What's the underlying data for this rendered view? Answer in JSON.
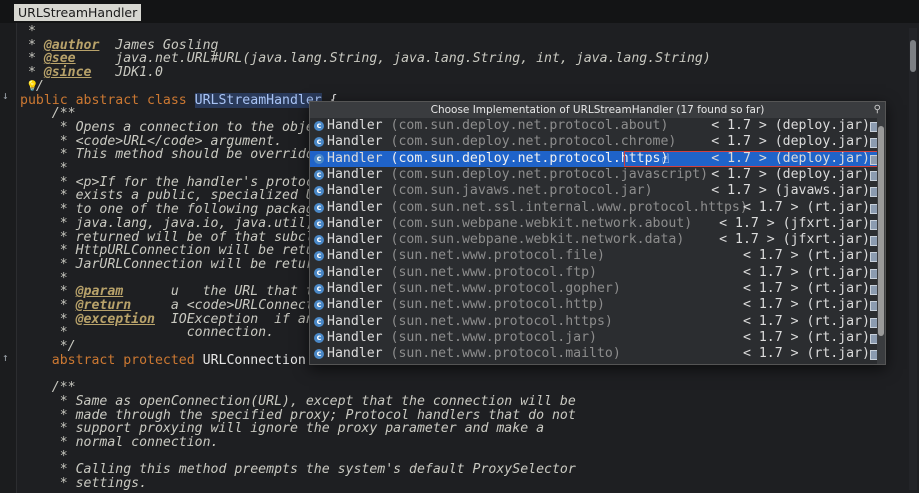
{
  "tab_title": "URLStreamHandler",
  "code_lines": [
    {
      "kind": "doc",
      "text": " *"
    },
    {
      "kind": "tagged",
      "tag": "@author",
      "rest": "  James Gosling"
    },
    {
      "kind": "tagged",
      "tag": "@see",
      "rest": "     java.net.URL#URL(java.lang.String, java.lang.String, int, java.lang.String)"
    },
    {
      "kind": "tagged",
      "tag": "@since",
      "rest": "   JDK1.0"
    },
    {
      "kind": "doc",
      "text": " */"
    },
    {
      "kind": "decl",
      "kw": "public abstract class ",
      "name": "URLStreamHandler",
      "rest": " {"
    },
    {
      "kind": "doc",
      "text": "    /**"
    },
    {
      "kind": "doc",
      "text": "     * Opens a connection to the objec"
    },
    {
      "kind": "doc",
      "text": "     * <code>URL</code> argument."
    },
    {
      "kind": "doc",
      "text": "     * This method should be overridde"
    },
    {
      "kind": "doc",
      "text": "     *"
    },
    {
      "kind": "doc",
      "text": "     * <p>If for the handler's protoco"
    },
    {
      "kind": "doc",
      "text": "     * exists a public, specialized UR"
    },
    {
      "kind": "doc",
      "text": "     * to one of the following package"
    },
    {
      "kind": "doc",
      "text": "     * java.lang, java.io, java.util, "
    },
    {
      "kind": "doc",
      "text": "     * returned will be of that subcla"
    },
    {
      "kind": "doc",
      "text": "     * HttpURLConnection will be retur"
    },
    {
      "kind": "doc",
      "text": "     * JarURLConnection will be return"
    },
    {
      "kind": "doc",
      "text": "     *"
    },
    {
      "kind": "tagged2",
      "tag": "@param",
      "rest": "      u   the URL that th"
    },
    {
      "kind": "tagged2",
      "tag": "@return",
      "rest": "     a <code>URLConnecti"
    },
    {
      "kind": "tagged2",
      "tag": "@exception",
      "rest": "  IOException  if an"
    },
    {
      "kind": "doc",
      "text": "     *               connection."
    },
    {
      "kind": "doc",
      "text": "     */"
    },
    {
      "kind": "decl2",
      "kw": "    abstract protected ",
      "rest": "URLConnection o"
    },
    {
      "kind": "doc",
      "text": ""
    },
    {
      "kind": "doc",
      "text": "    /**"
    },
    {
      "kind": "doc",
      "text": "     * Same as openConnection(URL), except that the connection will be"
    },
    {
      "kind": "doc",
      "text": "     * made through the specified proxy; Protocol handlers that do not"
    },
    {
      "kind": "doc",
      "text": "     * support proxying will ignore the proxy parameter and make a"
    },
    {
      "kind": "doc",
      "text": "     * normal connection."
    },
    {
      "kind": "doc",
      "text": "     *"
    },
    {
      "kind": "doc",
      "text": "     * Calling this method preempts the system's default ProxySelector"
    },
    {
      "kind": "doc",
      "text": "     * settings."
    }
  ],
  "popup": {
    "title": "Choose Implementation of URLStreamHandler (17 found so far)",
    "selected_index": 2,
    "items": [
      {
        "name": "Handler",
        "pkg": "(com.sun.deploy.net.protocol.about)",
        "version": "< 1.7 >",
        "jar": "(deploy.jar)"
      },
      {
        "name": "Handler",
        "pkg": "(com.sun.deploy.net.protocol.chrome)",
        "version": "< 1.7 >",
        "jar": "(deploy.jar)"
      },
      {
        "name": "Handler",
        "pkg": "(com.sun.deploy.net.protocol.https)",
        "version": "< 1.7 >",
        "jar": "(deploy.jar)"
      },
      {
        "name": "Handler",
        "pkg": "(com.sun.deploy.net.protocol.javascript)",
        "version": "< 1.7 >",
        "jar": "(deploy.jar)"
      },
      {
        "name": "Handler",
        "pkg": "(com.sun.javaws.net.protocol.jar)",
        "version": "< 1.7 >",
        "jar": "(javaws.jar)"
      },
      {
        "name": "Handler",
        "pkg": "(com.sun.net.ssl.internal.www.protocol.https)",
        "version": "< 1.7 >",
        "jar": "(rt.jar)"
      },
      {
        "name": "Handler",
        "pkg": "(com.sun.webpane.webkit.network.about)",
        "version": "< 1.7 >",
        "jar": "(jfxrt.jar)"
      },
      {
        "name": "Handler",
        "pkg": "(com.sun.webpane.webkit.network.data)",
        "version": "< 1.7 >",
        "jar": "(jfxrt.jar)"
      },
      {
        "name": "Handler",
        "pkg": "(sun.net.www.protocol.file)",
        "version": "< 1.7 >",
        "jar": "(rt.jar)"
      },
      {
        "name": "Handler",
        "pkg": "(sun.net.www.protocol.ftp)",
        "version": "< 1.7 >",
        "jar": "(rt.jar)"
      },
      {
        "name": "Handler",
        "pkg": "(sun.net.www.protocol.gopher)",
        "version": "< 1.7 >",
        "jar": "(rt.jar)"
      },
      {
        "name": "Handler",
        "pkg": "(sun.net.www.protocol.http)",
        "version": "< 1.7 >",
        "jar": "(rt.jar)"
      },
      {
        "name": "Handler",
        "pkg": "(sun.net.www.protocol.https)",
        "version": "< 1.7 >",
        "jar": "(rt.jar)"
      },
      {
        "name": "Handler",
        "pkg": "(sun.net.www.protocol.jar)",
        "version": "< 1.7 >",
        "jar": "(rt.jar)"
      },
      {
        "name": "Handler",
        "pkg": "(sun.net.www.protocol.mailto)",
        "version": "< 1.7 >",
        "jar": "(rt.jar)"
      }
    ]
  }
}
